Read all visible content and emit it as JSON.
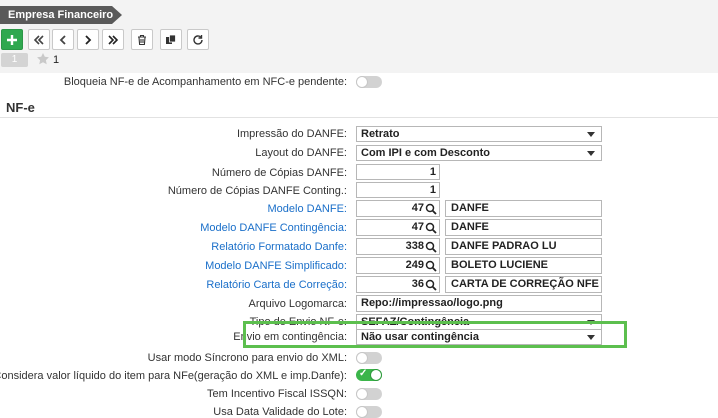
{
  "header": {
    "title": "Empresa Financeiro"
  },
  "toolbar": {
    "buttons": [
      {
        "name": "add-button",
        "icon": "plus-icon"
      },
      {
        "name": "first-record-button",
        "icon": "double-chevron-left-icon"
      },
      {
        "name": "previous-record-button",
        "icon": "chevron-left-icon"
      },
      {
        "name": "next-record-button",
        "icon": "chevron-right-icon"
      },
      {
        "name": "last-record-button",
        "icon": "double-chevron-right-icon"
      },
      {
        "name": "delete-button",
        "icon": "trash-icon"
      },
      {
        "name": "copy-button",
        "icon": "copy-icon"
      },
      {
        "name": "refresh-button",
        "icon": "refresh-icon"
      }
    ]
  },
  "records": {
    "current": "1",
    "favorites": "1"
  },
  "top_field": {
    "label": "Bloqueia NF-e de Acompanhamento em NFC-e pendente:",
    "value": false
  },
  "section": {
    "title": "NF-e"
  },
  "fields": {
    "impressao": {
      "label": "Impressão do DANFE:",
      "value": "Retrato"
    },
    "layout": {
      "label": "Layout do DANFE:",
      "value": "Com IPI e com Desconto"
    },
    "copias": {
      "label": "Número de Cópias DANFE:",
      "value": "1"
    },
    "copias_conting": {
      "label": "Número de Cópias DANFE Conting.:",
      "value": "1"
    },
    "modelo": {
      "label": "Modelo DANFE:",
      "code": "47",
      "desc": "DANFE"
    },
    "modelo_conting": {
      "label": "Modelo DANFE Contingência:",
      "code": "47",
      "desc": "DANFE"
    },
    "relatorio": {
      "label": "Relatório Formatado Danfe:",
      "code": "338",
      "desc": "DANFE PADRAO LU"
    },
    "simplificado": {
      "label": "Modelo DANFE Simplificado:",
      "code": "249",
      "desc": "BOLETO LUCIENE"
    },
    "carta": {
      "label": "Relatório Carta de Correção:",
      "code": "36",
      "desc": "CARTA DE CORREÇÃO NFE"
    },
    "logomarca": {
      "label": "Arquivo Logomarca:",
      "value": "Repo://impressao/logo.png"
    },
    "tipo_envio": {
      "label": "Tipo de Envio NF-e:",
      "value": "SEFAZ/Contingência"
    },
    "envio_conting": {
      "label": "Envio em contingência:",
      "value": "Não usar contingência"
    },
    "sincrono": {
      "label": "Usar modo Síncrono para envio do XML:",
      "value": false
    },
    "liquido": {
      "label": "Considera valor líquido do item para NFe(geração do XML e imp.Danfe):",
      "value": true
    },
    "issqn": {
      "label": "Tem Incentivo Fiscal ISSQN:",
      "value": false
    },
    "validade": {
      "label": "Usa Data Validade do Lote:",
      "value": false
    }
  },
  "colors": {
    "accent_green": "#2fa84f",
    "highlight": "#5cbf4e",
    "link": "#1a6fc9"
  }
}
